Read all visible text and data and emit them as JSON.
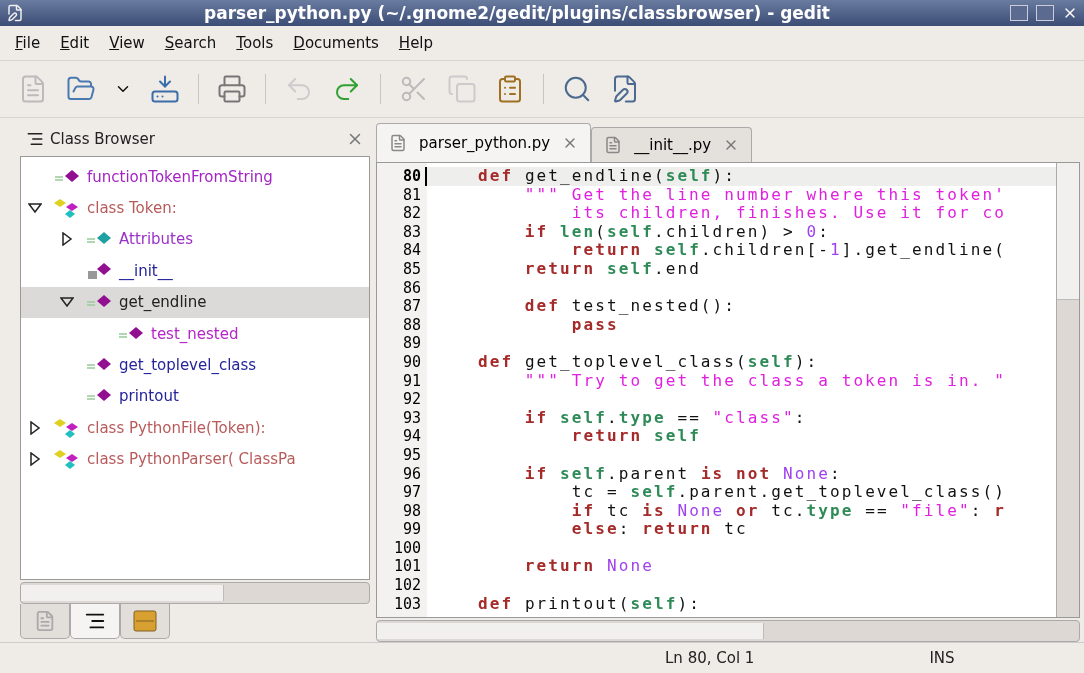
{
  "window": {
    "title": "parser_python.py (~/.gnome2/gedit/plugins/classbrowser) - gedit"
  },
  "menu": [
    "File",
    "Edit",
    "View",
    "Search",
    "Tools",
    "Documents",
    "Help"
  ],
  "side_panel": {
    "title": "Class Browser",
    "tree": [
      {
        "label": "functionTokenFromString",
        "kind": "function",
        "color": "#a424c4",
        "selected": false
      },
      {
        "label": "class Token:",
        "kind": "class",
        "color": "#b85a5a",
        "expanded": true,
        "selected": false,
        "children": [
          {
            "label": "Attributes",
            "kind": "attribute",
            "color": "#9a32c8",
            "expanded": false,
            "selected": false
          },
          {
            "label": "__init__",
            "kind": "private",
            "color": "#24249c",
            "selected": false
          },
          {
            "label": "get_endline",
            "kind": "function",
            "color": "#202020",
            "expanded": true,
            "selected": true,
            "children": [
              {
                "label": "test_nested",
                "kind": "function",
                "color": "#b424c8",
                "selected": false
              }
            ]
          },
          {
            "label": "get_toplevel_class",
            "kind": "function",
            "color": "#24249c",
            "selected": false
          },
          {
            "label": "printout",
            "kind": "function",
            "color": "#24249c",
            "selected": false
          }
        ]
      },
      {
        "label": "class PythonFile(Token):",
        "kind": "class",
        "color": "#b85a5a",
        "expanded": false,
        "selected": false
      },
      {
        "label": "class PythonParser( ClassPa",
        "kind": "class",
        "color": "#b85a5a",
        "expanded": false,
        "selected": false
      }
    ],
    "tabs": [
      {
        "kind": "document",
        "selected": false
      },
      {
        "kind": "list",
        "selected": true
      },
      {
        "kind": "box",
        "selected": false
      }
    ]
  },
  "editor": {
    "tabs": [
      {
        "label": "parser_python.py",
        "selected": true
      },
      {
        "label": "__init__.py",
        "selected": false
      }
    ],
    "lines": [
      {
        "number": "80",
        "current": true,
        "tokens": [
          {
            "kind": "kw",
            "text": "    def "
          },
          {
            "kind": "plain",
            "text": "get_endline("
          },
          {
            "kind": "self",
            "text": "self"
          },
          {
            "kind": "plain",
            "text": "):"
          }
        ]
      },
      {
        "number": "81",
        "current": false,
        "tokens": [
          {
            "kind": "str",
            "text": "        \"\"\" Get the line number where this token'"
          }
        ]
      },
      {
        "number": "82",
        "current": false,
        "tokens": [
          {
            "kind": "str",
            "text": "            its children, finishes. Use it for co"
          }
        ]
      },
      {
        "number": "83",
        "current": false,
        "tokens": [
          {
            "kind": "kw",
            "text": "        if "
          },
          {
            "kind": "self",
            "text": "len"
          },
          {
            "kind": "plain",
            "text": "("
          },
          {
            "kind": "self",
            "text": "self"
          },
          {
            "kind": "plain",
            "text": ".children) > "
          },
          {
            "kind": "const",
            "text": "0"
          },
          {
            "kind": "plain",
            "text": ":"
          }
        ]
      },
      {
        "number": "84",
        "current": false,
        "tokens": [
          {
            "kind": "kw",
            "text": "            return "
          },
          {
            "kind": "self",
            "text": "self"
          },
          {
            "kind": "plain",
            "text": ".children[-"
          },
          {
            "kind": "const",
            "text": "1"
          },
          {
            "kind": "plain",
            "text": "].get_endline("
          }
        ]
      },
      {
        "number": "85",
        "current": false,
        "tokens": [
          {
            "kind": "kw",
            "text": "        return "
          },
          {
            "kind": "self",
            "text": "self"
          },
          {
            "kind": "plain",
            "text": ".end"
          }
        ]
      },
      {
        "number": "86",
        "current": false
      },
      {
        "number": "87",
        "current": false,
        "tokens": [
          {
            "kind": "kw",
            "text": "        def "
          },
          {
            "kind": "plain",
            "text": "test_nested():"
          }
        ]
      },
      {
        "number": "88",
        "current": false,
        "tokens": [
          {
            "kind": "kw",
            "text": "            pass"
          }
        ]
      },
      {
        "number": "89",
        "current": false
      },
      {
        "number": "90",
        "current": false,
        "tokens": [
          {
            "kind": "kw",
            "text": "    def "
          },
          {
            "kind": "plain",
            "text": "get_toplevel_class("
          },
          {
            "kind": "self",
            "text": "self"
          },
          {
            "kind": "plain",
            "text": "):"
          }
        ]
      },
      {
        "number": "91",
        "current": false,
        "tokens": [
          {
            "kind": "str",
            "text": "        \"\"\" Try to get the class a token is in. \""
          }
        ]
      },
      {
        "number": "92",
        "current": false
      },
      {
        "number": "93",
        "current": false,
        "tokens": [
          {
            "kind": "kw",
            "text": "        if "
          },
          {
            "kind": "self",
            "text": "self"
          },
          {
            "kind": "plain",
            "text": "."
          },
          {
            "kind": "self",
            "text": "type"
          },
          {
            "kind": "plain",
            "text": " == "
          },
          {
            "kind": "str",
            "text": "\"class\""
          },
          {
            "kind": "plain",
            "text": ":"
          }
        ]
      },
      {
        "number": "94",
        "current": false,
        "tokens": [
          {
            "kind": "kw",
            "text": "            return "
          },
          {
            "kind": "self",
            "text": "self"
          }
        ]
      },
      {
        "number": "95",
        "current": false
      },
      {
        "number": "96",
        "current": false,
        "tokens": [
          {
            "kind": "kw",
            "text": "        if "
          },
          {
            "kind": "self",
            "text": "self"
          },
          {
            "kind": "plain",
            "text": ".parent "
          },
          {
            "kind": "kw",
            "text": "is not "
          },
          {
            "kind": "const",
            "text": "None"
          },
          {
            "kind": "plain",
            "text": ":"
          }
        ]
      },
      {
        "number": "97",
        "current": false,
        "tokens": [
          {
            "kind": "plain",
            "text": "            tc = "
          },
          {
            "kind": "self",
            "text": "self"
          },
          {
            "kind": "plain",
            "text": ".parent.get_toplevel_class()"
          }
        ]
      },
      {
        "number": "98",
        "current": false,
        "tokens": [
          {
            "kind": "kw",
            "text": "            if "
          },
          {
            "kind": "plain",
            "text": "tc "
          },
          {
            "kind": "kw",
            "text": "is "
          },
          {
            "kind": "const",
            "text": "None "
          },
          {
            "kind": "kw",
            "text": "or "
          },
          {
            "kind": "plain",
            "text": "tc."
          },
          {
            "kind": "self",
            "text": "type"
          },
          {
            "kind": "plain",
            "text": " == "
          },
          {
            "kind": "str",
            "text": "\"file\""
          },
          {
            "kind": "plain",
            "text": ": "
          },
          {
            "kind": "kw",
            "text": "r"
          }
        ]
      },
      {
        "number": "99",
        "current": false,
        "tokens": [
          {
            "kind": "kw",
            "text": "            else"
          },
          {
            "kind": "plain",
            "text": ": "
          },
          {
            "kind": "kw",
            "text": "return "
          },
          {
            "kind": "plain",
            "text": "tc"
          }
        ]
      },
      {
        "number": "100",
        "current": false
      },
      {
        "number": "101",
        "current": false,
        "tokens": [
          {
            "kind": "kw",
            "text": "        return "
          },
          {
            "kind": "const",
            "text": "None"
          }
        ]
      },
      {
        "number": "102",
        "current": false
      },
      {
        "number": "103",
        "current": false,
        "tokens": [
          {
            "kind": "kw",
            "text": "    def "
          },
          {
            "kind": "plain",
            "text": "printout("
          },
          {
            "kind": "self",
            "text": "self"
          },
          {
            "kind": "plain",
            "text": "):"
          }
        ]
      }
    ]
  },
  "status_bar": {
    "position": "Ln 80, Col 1",
    "mode": "INS"
  }
}
